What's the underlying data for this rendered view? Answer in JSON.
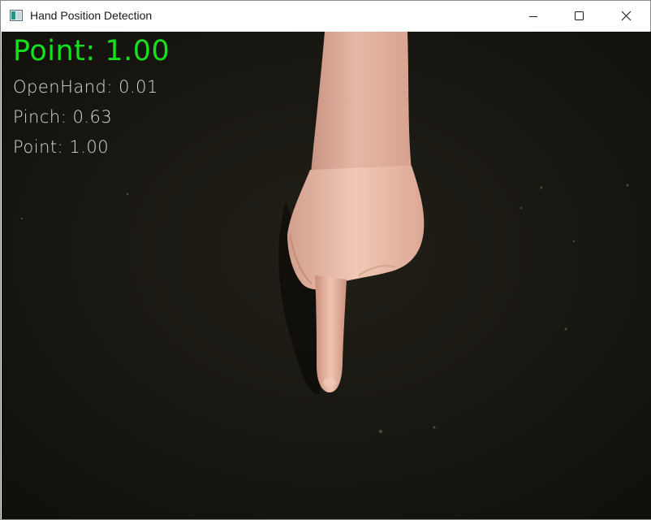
{
  "window": {
    "title": "Hand Position Detection",
    "icons": {
      "app": "app-window-icon",
      "minimize": "minimize-icon",
      "maximize": "maximize-icon",
      "close": "close-icon"
    }
  },
  "detection": {
    "top_label": "Point: 1.00",
    "top_label_color": "#16e01c",
    "scores": [
      {
        "text": "OpenHand: 0.01"
      },
      {
        "text": "Pinch: 0.63"
      },
      {
        "text": "Point: 1.00"
      }
    ],
    "score_color": "#d9d9d9"
  },
  "camera": {
    "background_color": "#1a1812",
    "subject": "hand-pointing-down"
  }
}
